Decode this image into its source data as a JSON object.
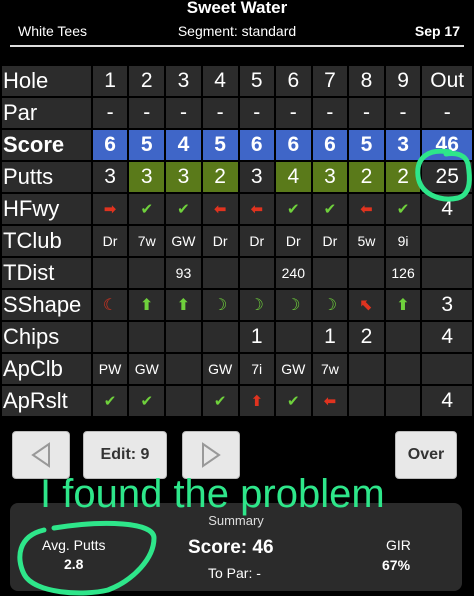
{
  "header": {
    "title": "Sweet Water",
    "tees": "White Tees",
    "segment": "Segment: standard",
    "date": "Sep 17"
  },
  "scorecard": {
    "rows": [
      {
        "label": "Hole",
        "style": "big",
        "cells": [
          "1",
          "2",
          "3",
          "4",
          "5",
          "6",
          "7",
          "8",
          "9",
          "Out"
        ]
      },
      {
        "label": "Par",
        "style": "big",
        "cells": [
          "-",
          "-",
          "-",
          "-",
          "-",
          "-",
          "-",
          "-",
          "-",
          "-"
        ]
      },
      {
        "label": "Score",
        "style": "score",
        "cells": [
          "6",
          "5",
          "4",
          "5",
          "6",
          "6",
          "6",
          "5",
          "3",
          "46"
        ]
      },
      {
        "label": "Putts",
        "style": "big",
        "cells": [
          "3",
          "3",
          "3",
          "2",
          "3",
          "4",
          "3",
          "2",
          "2",
          "25"
        ],
        "green": [
          1,
          2,
          3,
          5,
          6,
          7,
          8
        ]
      },
      {
        "label": "HFwy",
        "style": "sym",
        "cells": [
          "➡",
          "✔",
          "✔",
          "⬅",
          "⬅",
          "✔",
          "✔",
          "⬅",
          "✔",
          "4"
        ],
        "red": [
          0,
          3,
          4,
          7
        ],
        "grn": [
          1,
          2,
          5,
          6,
          8
        ]
      },
      {
        "label": "TClub",
        "style": "small",
        "cells": [
          "Dr",
          "7w",
          "GW",
          "Dr",
          "Dr",
          "Dr",
          "Dr",
          "5w",
          "9i",
          ""
        ]
      },
      {
        "label": "TDist",
        "style": "small",
        "cells": [
          "",
          "",
          "93",
          "",
          "",
          "240",
          "",
          "",
          "126",
          ""
        ]
      },
      {
        "label": "SShape",
        "style": "sym",
        "cells": [
          "☾",
          "⬆",
          "⬆",
          "☽",
          "☽",
          "☽",
          "☽",
          "⬉",
          "⬆",
          "3"
        ],
        "red": [
          0,
          7
        ],
        "grn": [
          1,
          2,
          3,
          4,
          5,
          6,
          8
        ]
      },
      {
        "label": "Chips",
        "style": "big",
        "cells": [
          "",
          "",
          "",
          "",
          "1",
          "",
          "1",
          "2",
          "",
          "4"
        ]
      },
      {
        "label": "ApClb",
        "style": "small",
        "cells": [
          "PW",
          "GW",
          "",
          "GW",
          "7i",
          "GW",
          "7w",
          "",
          "",
          ""
        ]
      },
      {
        "label": "ApRslt",
        "style": "sym",
        "cells": [
          "✔",
          "✔",
          "",
          "✔",
          "⬆",
          "✔",
          "⬅",
          "",
          "",
          "4"
        ],
        "red": [
          4,
          6
        ],
        "grn": [
          0,
          1,
          3,
          5
        ]
      }
    ]
  },
  "controls": {
    "prev_icon": "triangle-left-icon",
    "edit_label": "Edit: 9",
    "next_icon": "triangle-right-icon",
    "over_label": "Over"
  },
  "annotation": {
    "text": "I found the problem",
    "color": "#2ee68a"
  },
  "summary": {
    "title": "Summary",
    "avg_putts_label": "Avg. Putts",
    "avg_putts_value": "2.8",
    "score_label": "Score: 46",
    "to_par_label": "To Par: -",
    "gir_label": "GIR",
    "gir_value": "67%"
  },
  "colors": {
    "score_row": "#3f66c8",
    "green_cell": "#5a7a1a",
    "cell_bg": "#2c2c2c"
  }
}
